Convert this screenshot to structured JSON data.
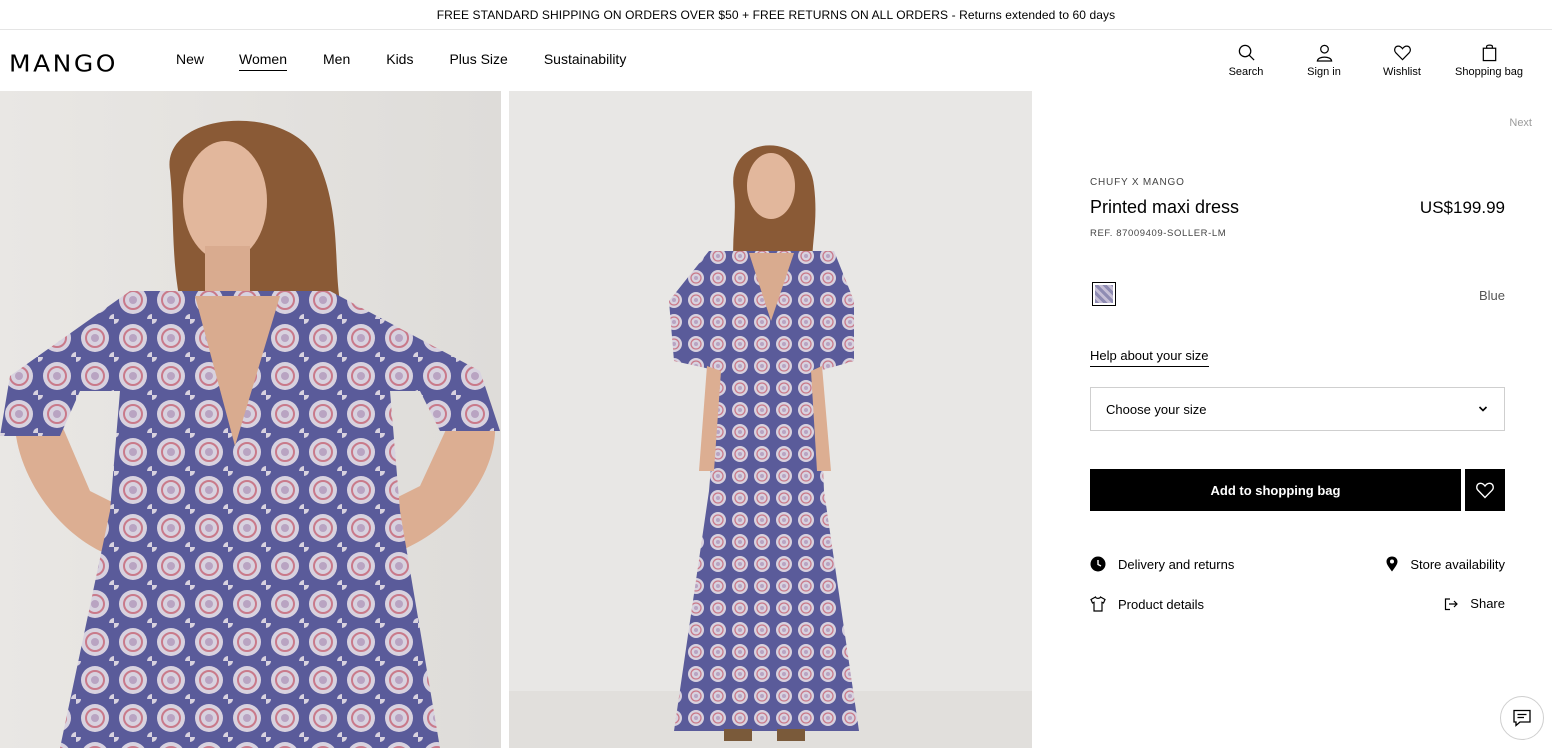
{
  "promo": {
    "text": "FREE STANDARD SHIPPING ON ORDERS OVER $50 + FREE RETURNS ON ALL ORDERS - Returns extended to 60 days"
  },
  "header": {
    "logo": "MANGO",
    "nav": [
      "New",
      "Women",
      "Men",
      "Kids",
      "Plus Size",
      "Sustainability"
    ],
    "active_nav": "Women",
    "tools": {
      "search": "Search",
      "sign_in": "Sign in",
      "wishlist": "Wishlist",
      "bag": "Shopping bag"
    }
  },
  "product": {
    "next": "Next",
    "brand": "CHUFY X MANGO",
    "name": "Printed maxi dress",
    "price": "US$199.99",
    "ref": "REF. 87009409-SOLLER-LM",
    "color": "Blue",
    "size_help": "Help about your size",
    "size_placeholder": "Choose your size",
    "add_to_bag": "Add to shopping bag",
    "links": {
      "delivery": "Delivery and returns",
      "store": "Store availability",
      "details": "Product details",
      "share": "Share"
    }
  },
  "colors": {
    "accent": "#000000",
    "promo_border": "#e5e5e5",
    "photo_bg": "#ebe9e6",
    "dress_blue": "#5a5b9a",
    "dress_pink": "#c9a3b2"
  }
}
